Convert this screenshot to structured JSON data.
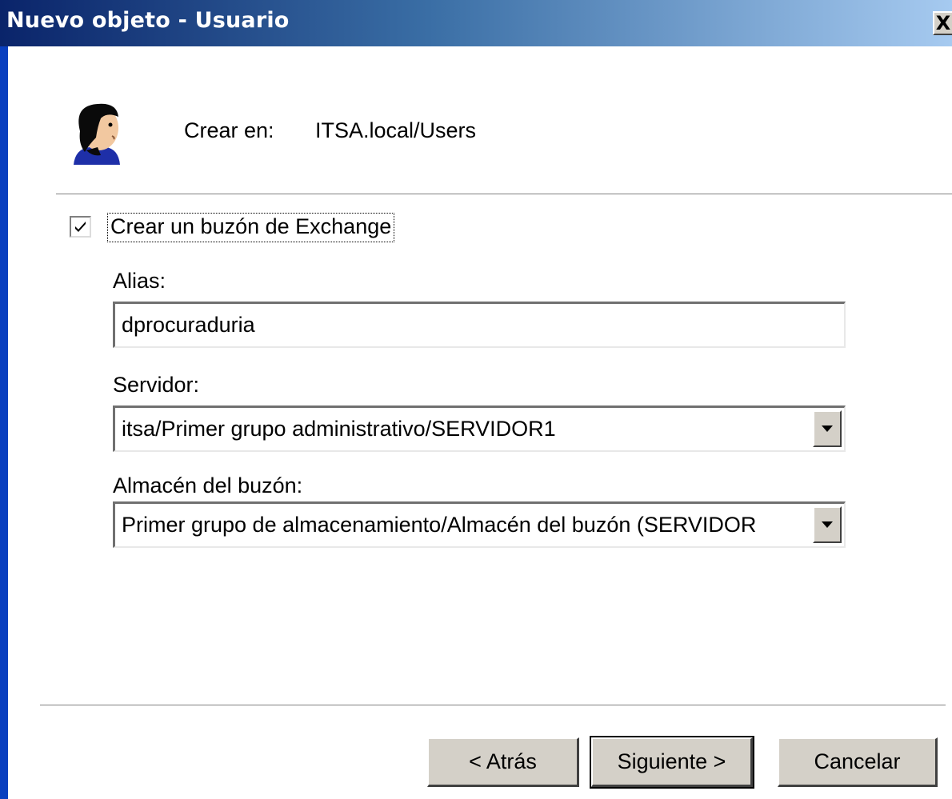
{
  "window": {
    "title": "Nuevo objeto - Usuario",
    "close_glyph": "X"
  },
  "header": {
    "icon": "user-icon",
    "create_in_label": "Crear en:",
    "create_in_value": "ITSA.local/Users"
  },
  "mailbox": {
    "checked": true,
    "checkbox_label": "Crear un buzón de Exchange"
  },
  "fields": {
    "alias_label": "Alias:",
    "alias_value": "dprocuraduria",
    "server_label": "Servidor:",
    "server_value": "itsa/Primer grupo administrativo/SERVIDOR1",
    "store_label": "Almacén del buzón:",
    "store_value": "Primer grupo de almacenamiento/Almacén del buzón (SERVIDOR"
  },
  "buttons": {
    "back": "< Atrás",
    "next": "Siguiente >",
    "cancel": "Cancelar"
  },
  "colors": {
    "titlebar_start": "#0a246a",
    "titlebar_end": "#a6caf0",
    "button_face": "#d4d0c8"
  }
}
